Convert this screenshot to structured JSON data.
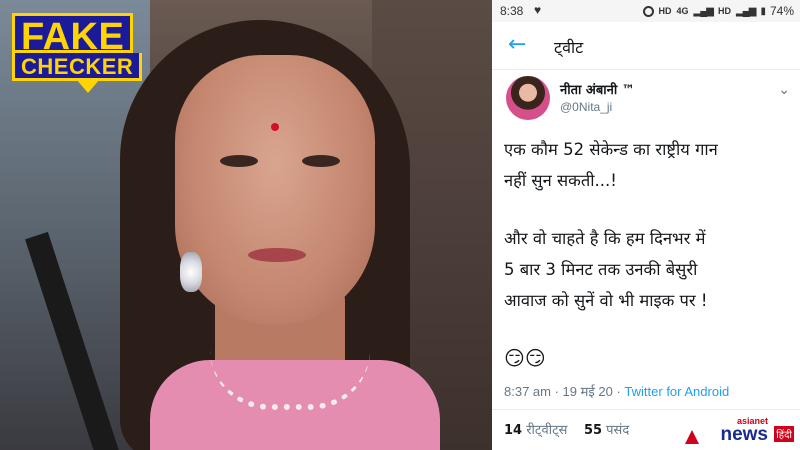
{
  "badge": {
    "line1": "FAKE",
    "line2": "CHECKER"
  },
  "status": {
    "time": "8:38",
    "heart": "♥",
    "hd1": "HD",
    "network": "4G",
    "hd2": "HD",
    "battery": "74%"
  },
  "appbar": {
    "back": "←",
    "title": "ट्वीट"
  },
  "author": {
    "name": "नीता अंबानी ™",
    "handle": "@0Nita_ji",
    "menu": "⌄"
  },
  "tweet": {
    "p1_line1": "एक कौम 52 सेकेन्ड का राष्ट्रीय गान",
    "p1_line2": "नहीं सुन सकती...!",
    "p2_line1": "और वो चाहते है कि हम दिनभर में",
    "p2_line2": "5 बार  3 मिनट तक उनकी बेसुरी",
    "p2_line3": "आवाज को सुनें वो भी माइक पर !",
    "emoji": "😏😏"
  },
  "meta": {
    "time": "8:37 am",
    "sep1": " · ",
    "date": "19 मई 20",
    "sep2": " · ",
    "source": "Twitter for Android"
  },
  "stats": {
    "retweets_count": "14",
    "retweets_label": "रीट्वीट्स",
    "likes_count": "55",
    "likes_label": "पसंद"
  },
  "watermark": {
    "top": "asianet",
    "brand": "news",
    "lang": "हिंदी"
  }
}
